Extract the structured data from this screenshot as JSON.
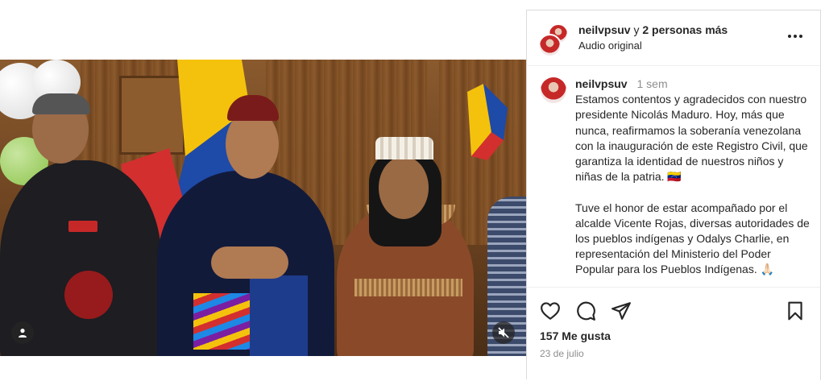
{
  "post": {
    "header": {
      "username": "neilvpsuv",
      "joiner": "y",
      "others": "2 personas más",
      "audio": "Audio original"
    },
    "caption": {
      "username": "neilvpsuv",
      "time": "1 sem",
      "paragraph1": "Estamos contentos y agradecidos con nuestro presidente Nicolás Maduro. Hoy, más que nunca, reafirmamos la soberanía venezolana con la inauguración de este Registro Civil, que garantiza la identidad de nuestros niños y niñas de la patria. 🇻🇪",
      "paragraph2": "Tuve el honor de estar acompañado por el alcalde Vicente Rojas, diversas autoridades de los pueblos indígenas y Odalys Charlie, en representación del Ministerio del Poder Popular para los Pueblos Indígenas. 🙏🏻"
    },
    "likes": "157 Me gusta",
    "date": "23 de julio"
  },
  "icons": {
    "like": "heart-icon",
    "comment": "comment-icon",
    "share": "send-icon",
    "save": "bookmark-icon",
    "tag": "user-tag-icon",
    "mute": "speaker-muted-icon",
    "options": "more-horizontal-icon"
  },
  "colors": {
    "text": "#262626",
    "muted": "#8e8e8e",
    "border": "#dbdbdb",
    "video_button_bg": "#262626"
  }
}
